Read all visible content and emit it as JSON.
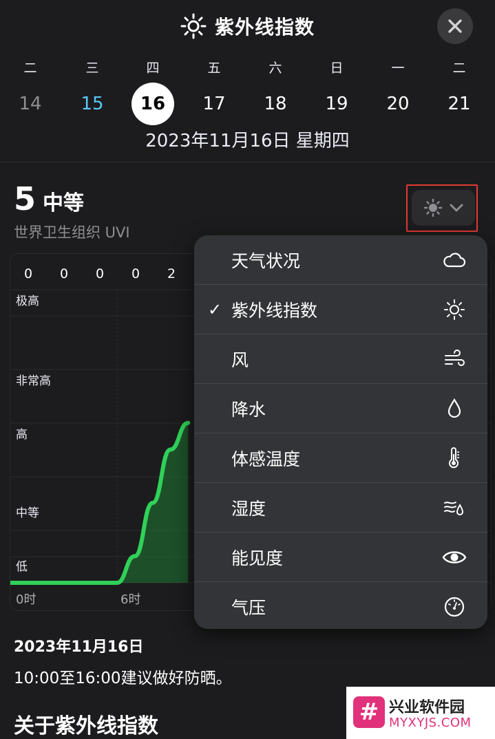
{
  "header": {
    "title": "紫外线指数",
    "title_icon": "sun-icon",
    "close_icon": "close-icon"
  },
  "week": {
    "weekdays": [
      "二",
      "三",
      "四",
      "五",
      "六",
      "日",
      "一",
      "二"
    ],
    "dates": [
      "14",
      "15",
      "16",
      "17",
      "18",
      "19",
      "20",
      "21"
    ],
    "selected_index": 2,
    "today_index": 1,
    "full_date": "2023年11月16日 星期四"
  },
  "uv": {
    "value": "5",
    "level": "中等",
    "scale_label": "世界卫生组织 UVI"
  },
  "chart": {
    "hour_values": [
      "0",
      "0",
      "0",
      "0",
      "2"
    ],
    "levels": [
      "极高",
      "非常高",
      "高",
      "中等",
      "低"
    ],
    "x_labels": [
      "0时",
      "6时"
    ]
  },
  "chart_data": {
    "type": "area",
    "x_unit": "hour",
    "x": [
      0,
      6,
      7,
      8,
      9,
      10
    ],
    "y": [
      0,
      0,
      1,
      3,
      5,
      6
    ],
    "ylim": [
      0,
      11
    ],
    "colors": {
      "line": "#30d158",
      "fill": "#1f7a33"
    }
  },
  "summary": {
    "date": "2023年11月16日",
    "text": "10:00至16:00建议做好防晒。",
    "about_title": "关于紫外线指数"
  },
  "menu": {
    "items": [
      {
        "label": "天气状况",
        "icon": "cloud-icon",
        "checked": false
      },
      {
        "label": "紫外线指数",
        "icon": "sun-icon",
        "checked": true
      },
      {
        "label": "风",
        "icon": "wind-icon",
        "checked": false
      },
      {
        "label": "降水",
        "icon": "raindrop-icon",
        "checked": false
      },
      {
        "label": "体感温度",
        "icon": "thermometer-icon",
        "checked": false
      },
      {
        "label": "湿度",
        "icon": "humidity-icon",
        "checked": false
      },
      {
        "label": "能见度",
        "icon": "eye-icon",
        "checked": false
      },
      {
        "label": "气压",
        "icon": "gauge-icon",
        "checked": false
      }
    ],
    "check_mark": "✓"
  },
  "watermark": {
    "logo_glyph": "#",
    "name": "兴业软件园",
    "url": "MYXYJS.COM"
  },
  "colors": {
    "background": "#1c1c1e",
    "accent_today": "#5ac8fa",
    "chart_green": "#30d158",
    "highlight_red": "#e53935"
  }
}
